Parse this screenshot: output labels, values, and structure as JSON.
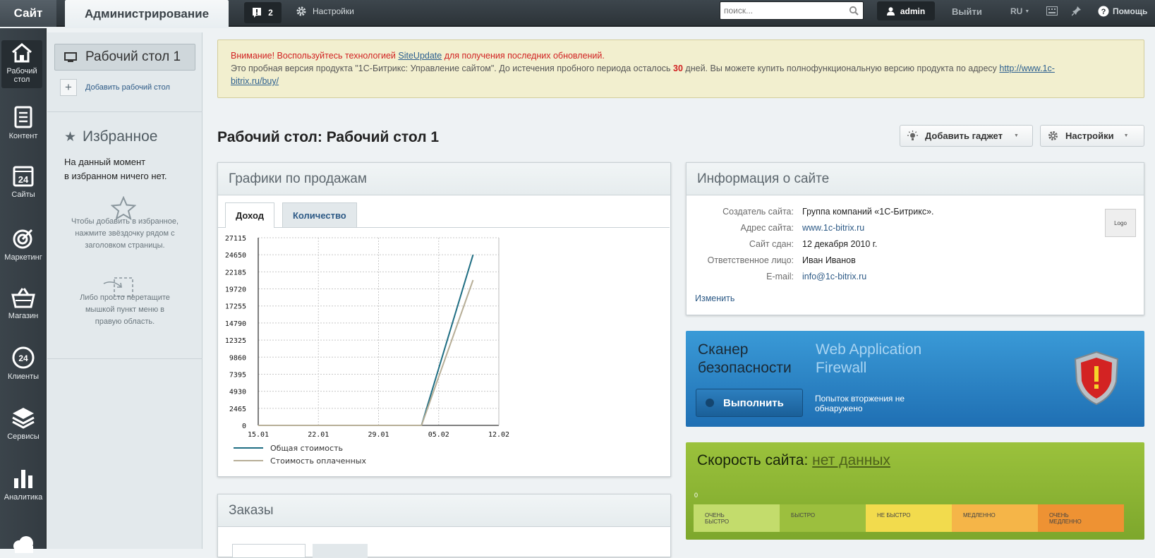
{
  "topbar": {
    "site": "Сайт",
    "admin": "Администрирование",
    "notifications": "2",
    "settings": "Настройки",
    "search_placeholder": "поиск...",
    "user": "admin",
    "logout": "Выйти",
    "lang": "RU",
    "help": "Помощь"
  },
  "leftnav": [
    {
      "label": "Рабочий стол",
      "icon": "home-icon"
    },
    {
      "label": "Контент",
      "icon": "document-icon"
    },
    {
      "label": "Сайты",
      "icon": "calendar-24-icon"
    },
    {
      "label": "Маркетинг",
      "icon": "target-icon"
    },
    {
      "label": "Магазин",
      "icon": "basket-icon"
    },
    {
      "label": "Клиенты",
      "icon": "clients-24-icon"
    },
    {
      "label": "Сервисы",
      "icon": "layers-icon"
    },
    {
      "label": "Аналитика",
      "icon": "bar-chart-icon"
    },
    {
      "label": "",
      "icon": "cloud-icon"
    }
  ],
  "sidebar": {
    "desktop": "Рабочий стол 1",
    "add_desktop": "Добавить рабочий стол",
    "fav_title": "Избранное",
    "fav_text_1": "На данный момент",
    "fav_text_2": "в избранном ничего нет.",
    "hint_star_1": "Чтобы добавить в избранное,",
    "hint_star_2": "нажмите звёздочку рядом с",
    "hint_star_3": "заголовком страницы.",
    "hint_drag_1": "Либо просто перетащите",
    "hint_drag_2": "мышкой пункт меню в",
    "hint_drag_3": "правую область."
  },
  "alert": {
    "line1_a": "Внимание! Воспользуйтесь технологией ",
    "line1_link": "SiteUpdate",
    "line1_b": " для получения последних обновлений.",
    "line2_a": "Это пробная версия продукта \"1С-Битрикс: Управление сайтом\". До истечения пробного периода осталось ",
    "days": "30",
    "line2_b": " дней. Вы можете купить полнофункциональную версию продукта по адресу ",
    "line2_link_1": "http://www.1c-",
    "line2_link_2": "bitrix.ru/buy/"
  },
  "page_title": "Рабочий стол: Рабочий стол 1",
  "buttons": {
    "add_gadget": "Добавить гаджет",
    "settings": "Настройки"
  },
  "sales": {
    "title": "Графики по продажам",
    "tab_income": "Доход",
    "tab_count": "Количество"
  },
  "chart_data": {
    "type": "line",
    "x": [
      "15.01",
      "22.01",
      "29.01",
      "05.02",
      "12.02"
    ],
    "y_ticks": [
      0,
      2465,
      4930,
      7395,
      9860,
      12325,
      14790,
      17255,
      19720,
      22185,
      24650,
      27115
    ],
    "ylim": [
      0,
      27115
    ],
    "series": [
      {
        "name": "Общая стоимость",
        "color": "#1f6e83",
        "points": [
          [
            "15.01",
            0
          ],
          [
            "03.02",
            0
          ],
          [
            "09.02",
            24650
          ]
        ]
      },
      {
        "name": "Стоимость оплаченных",
        "color": "#b7ae97",
        "points": [
          [
            "15.01",
            0
          ],
          [
            "03.02",
            0
          ],
          [
            "09.02",
            21000
          ]
        ]
      }
    ],
    "grid": true
  },
  "orders": {
    "title": "Заказы"
  },
  "siteinfo": {
    "title": "Информация о сайте",
    "rows": [
      {
        "k": "Создатель сайта:",
        "v": "Группа компаний «1С-Битрикс».",
        "link": false
      },
      {
        "k": "Адрес сайта:",
        "v": "www.1c-bitrix.ru",
        "link": true
      },
      {
        "k": "Сайт сдан:",
        "v": "12 декабря 2010 г.",
        "link": false
      },
      {
        "k": "Ответственное лицо:",
        "v": "Иван Иванов",
        "link": false
      },
      {
        "k": "E-mail:",
        "v": "info@1c-bitrix.ru",
        "link": true
      }
    ],
    "edit": "Изменить",
    "logo": "Logo"
  },
  "scanner": {
    "title_1": "Сканер",
    "title_2": "безопасности",
    "waf_1": "Web Application",
    "waf_2": "Firewall",
    "run": "Выполнить",
    "status_1": "Попыток вторжения не",
    "status_2": "обнаружено"
  },
  "speed": {
    "title": "Скорость сайта:",
    "value": "нет данных",
    "marker": "0",
    "scale": [
      {
        "l1": "ОЧЕНЬ",
        "l2": "БЫСТРО",
        "color": "#c3dc6c"
      },
      {
        "l1": "БЫСТРО",
        "l2": "",
        "color": "#9cbf3e"
      },
      {
        "l1": "НЕ БЫСТРО",
        "l2": "",
        "color": "#f2db4d"
      },
      {
        "l1": "МЕДЛЕННО",
        "l2": "",
        "color": "#f5b548"
      },
      {
        "l1": "ОЧЕНЬ",
        "l2": "МЕДЛЕННО",
        "color": "#ee9233"
      }
    ]
  }
}
